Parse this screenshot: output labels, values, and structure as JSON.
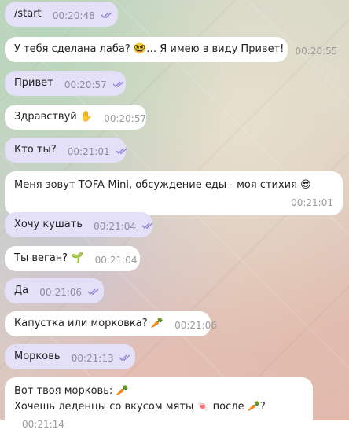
{
  "messages": [
    {
      "text": "/start",
      "time": "00:20:48",
      "direction": "out",
      "read": true
    },
    {
      "text": "У тебя сделана лаба? 🤓… Я имею в виду Привет!",
      "time": "00:20:55",
      "direction": "in",
      "read": false
    },
    {
      "text": "Привет",
      "time": "00:20:57",
      "direction": "out",
      "read": true
    },
    {
      "text": "Здравствуй ✋",
      "time": "00:20:57",
      "direction": "in",
      "read": false
    },
    {
      "text": "Кто ты?",
      "time": "00:21:01",
      "direction": "out",
      "read": true
    },
    {
      "text": "Меня зовут TOFA-Mini, обсуждение еды - моя стихия 😎",
      "time": "00:21:01",
      "direction": "in",
      "read": false
    },
    {
      "text": "Хочу кушать",
      "time": "00:21:04",
      "direction": "out",
      "read": true
    },
    {
      "text": "Ты веган? 🌱",
      "time": "00:21:04",
      "direction": "in",
      "read": false
    },
    {
      "text": "Да",
      "time": "00:21:06",
      "direction": "out",
      "read": true
    },
    {
      "text": "Капустка или морковка? 🥕",
      "time": "00:21:06",
      "direction": "in",
      "read": false
    },
    {
      "text": "Морковь",
      "time": "00:21:13",
      "direction": "out",
      "read": true
    },
    {
      "lines": [
        "Вот твоя морковь: 🥕",
        "Хочешь леденцы со вкусом мяты 🍬 после 🥕?"
      ],
      "time": "00:21:14",
      "direction": "in",
      "read": false
    }
  ],
  "colors": {
    "outgoing_bubble": "#e3e0f7",
    "incoming_bubble": "#ffffff",
    "read_check": "#8c83d6",
    "timestamp": "#8d8da0"
  }
}
